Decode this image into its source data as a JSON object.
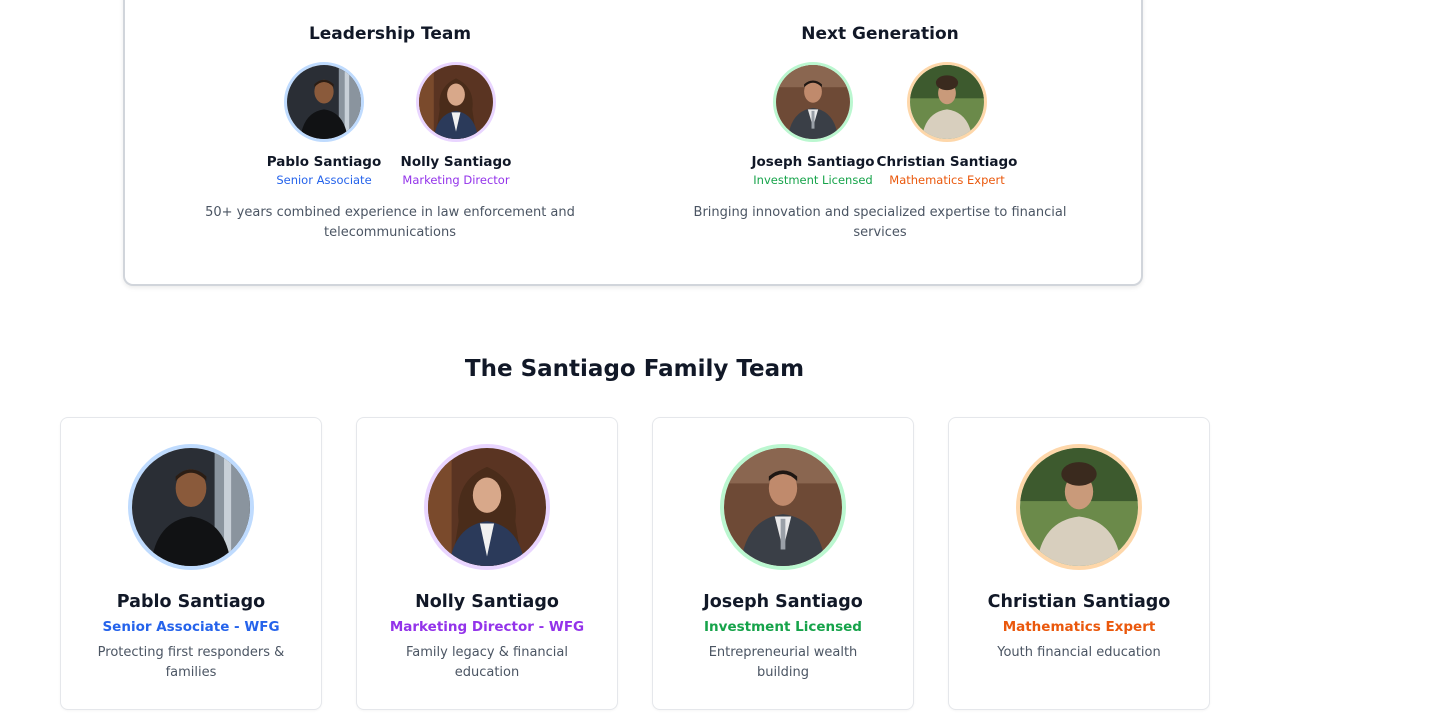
{
  "leadership": {
    "title": "Leadership Team",
    "members": [
      {
        "name": "Pablo Santiago",
        "role": "Senior Associate"
      },
      {
        "name": "Nolly Santiago",
        "role": "Marketing Director"
      }
    ],
    "description": "50+ years combined experience in law enforcement and telecommunications"
  },
  "next_generation": {
    "title": "Next Generation",
    "members": [
      {
        "name": "Joseph Santiago",
        "role": "Investment Licensed"
      },
      {
        "name": "Christian Santiago",
        "role": "Mathematics Expert"
      }
    ],
    "description": "Bringing innovation and specialized expertise to financial services"
  },
  "family_team": {
    "title": "The Santiago Family Team",
    "cards": [
      {
        "name": "Pablo Santiago",
        "role": "Senior Associate - WFG",
        "description": "Protecting first responders & families",
        "accent": "#2563eb"
      },
      {
        "name": "Nolly Santiago",
        "role": "Marketing Director - WFG",
        "description": "Family legacy & financial education",
        "accent": "#9333ea"
      },
      {
        "name": "Joseph Santiago",
        "role": "Investment Licensed",
        "description": "Entrepreneurial wealth building",
        "accent": "#16a34a"
      },
      {
        "name": "Christian Santiago",
        "role": "Mathematics Expert",
        "description": "Youth financial education",
        "accent": "#ea580c"
      }
    ]
  }
}
